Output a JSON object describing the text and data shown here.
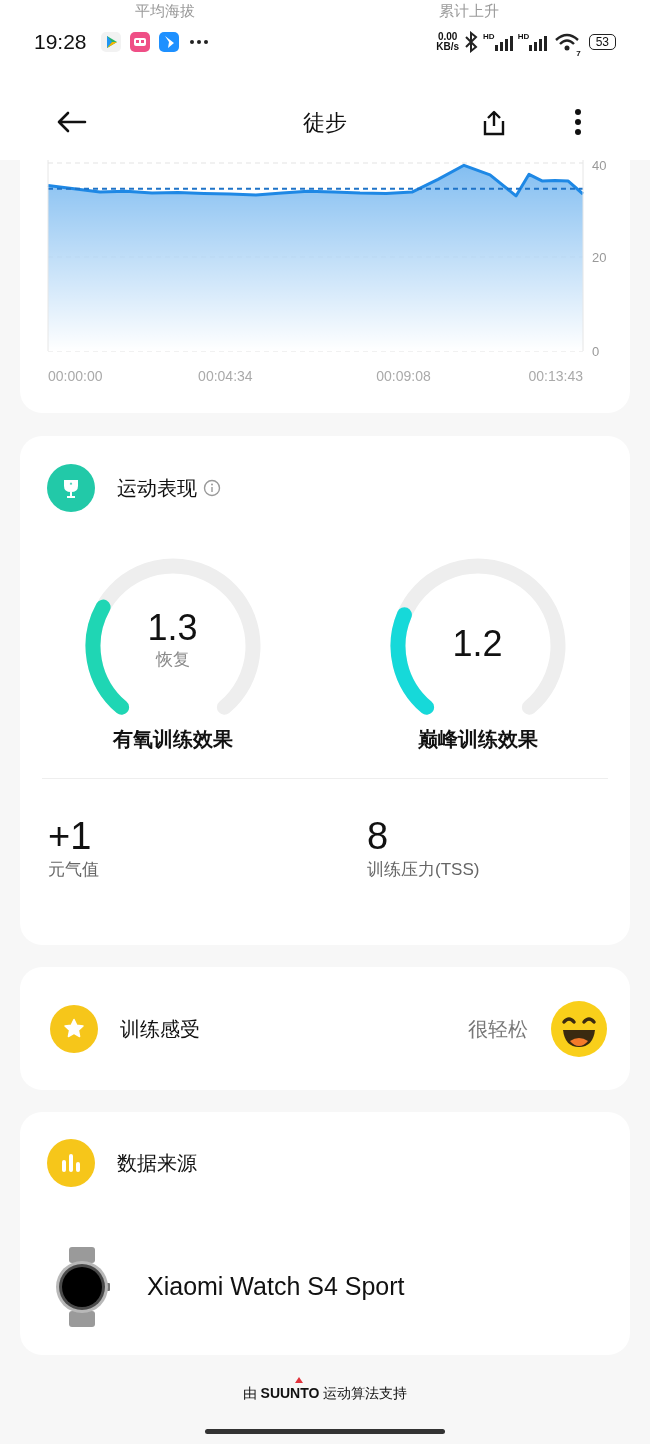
{
  "status_bar": {
    "time": "19:28",
    "net_speed": [
      "0.00",
      "KB/s"
    ],
    "signals": [
      {
        "label": "HD"
      },
      {
        "label": "HD"
      }
    ],
    "wifi_label": "7",
    "battery": "53"
  },
  "background_labels": [
    "平均海拔",
    "累计上升"
  ],
  "header": {
    "title": "徒步"
  },
  "chart": {
    "chart_data": {
      "type": "area",
      "x": [
        0,
        40,
        80,
        120,
        160,
        200,
        240,
        280,
        320,
        360,
        400,
        440,
        480,
        520,
        560,
        600,
        640,
        680,
        720,
        740,
        760,
        780,
        800,
        823
      ],
      "series": [
        {
          "color": "#1e88e5",
          "values": [
            35.2,
            34.5,
            33.8,
            34,
            33.6,
            33.7,
            33.5,
            33.4,
            33.2,
            33.6,
            34,
            33.8,
            33.6,
            33.5,
            33.8,
            36.5,
            39.5,
            37.5,
            33,
            37.6,
            36.2,
            36.3,
            36.2,
            33.4
          ]
        }
      ],
      "xlim": [
        0,
        823
      ],
      "ylim": [
        0,
        40
      ],
      "xticks": [
        {
          "value": 0,
          "label": "00:00:00"
        },
        {
          "value": 274,
          "label": "00:04:34"
        },
        {
          "value": 548,
          "label": "00:09:08"
        },
        {
          "value": 823,
          "label": "00:13:43"
        }
      ],
      "yticks": [
        0,
        20,
        40
      ],
      "ref_lines": [
        {
          "axis": "y",
          "value": 34.5
        }
      ]
    }
  },
  "performance": {
    "title": "运动表现",
    "gauges": [
      {
        "value": "1.3",
        "sublabel": "恢复",
        "caption": "有氧训练效果",
        "color": "#1fd6b4"
      },
      {
        "value": "1.2",
        "caption": "巅峰训练效果",
        "color": "#16d9d9"
      }
    ],
    "stats": [
      {
        "value": "+1",
        "label": "元气值"
      },
      {
        "value": "8",
        "label": "训练压力(TSS)"
      }
    ]
  },
  "feeling": {
    "title": "训练感受",
    "value": "很轻松"
  },
  "data_source": {
    "title": "数据来源",
    "device": "Xiaomi Watch S4 Sport"
  },
  "footer": {
    "prefix": "由",
    "brand": "SUUNTO",
    "suffix": "运动算法支持"
  }
}
